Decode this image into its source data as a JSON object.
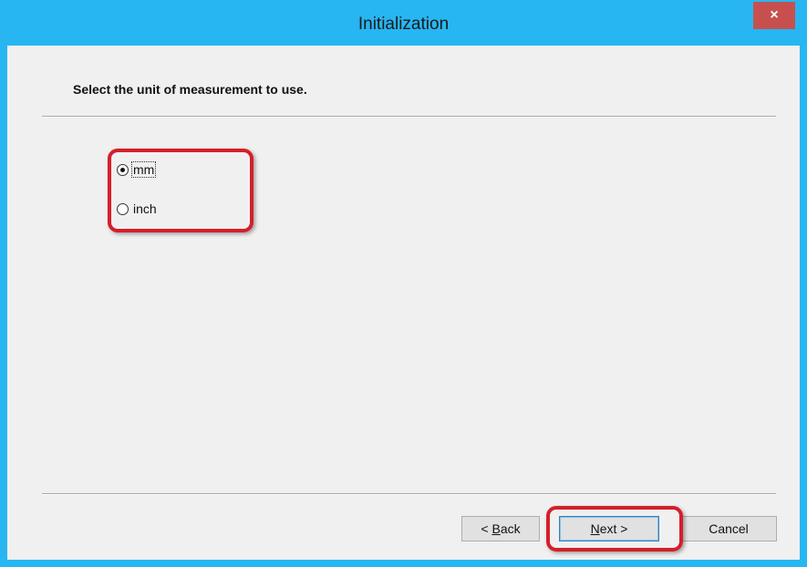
{
  "window": {
    "title": "Initialization",
    "close_label": "×"
  },
  "page": {
    "instruction": "Select the unit of measurement to use."
  },
  "units": {
    "options": [
      {
        "label": "mm",
        "selected": true
      },
      {
        "label": "inch",
        "selected": false
      }
    ]
  },
  "buttons": {
    "back": {
      "prefix": "< ",
      "mnemonic": "B",
      "rest": "ack"
    },
    "next": {
      "mnemonic": "N",
      "rest": "ext >"
    },
    "cancel": "Cancel"
  },
  "colors": {
    "titlebar": "#27b6f2",
    "close_button": "#c7504f",
    "highlight": "#d51f2a",
    "dialog_background": "#f0f0f0"
  }
}
